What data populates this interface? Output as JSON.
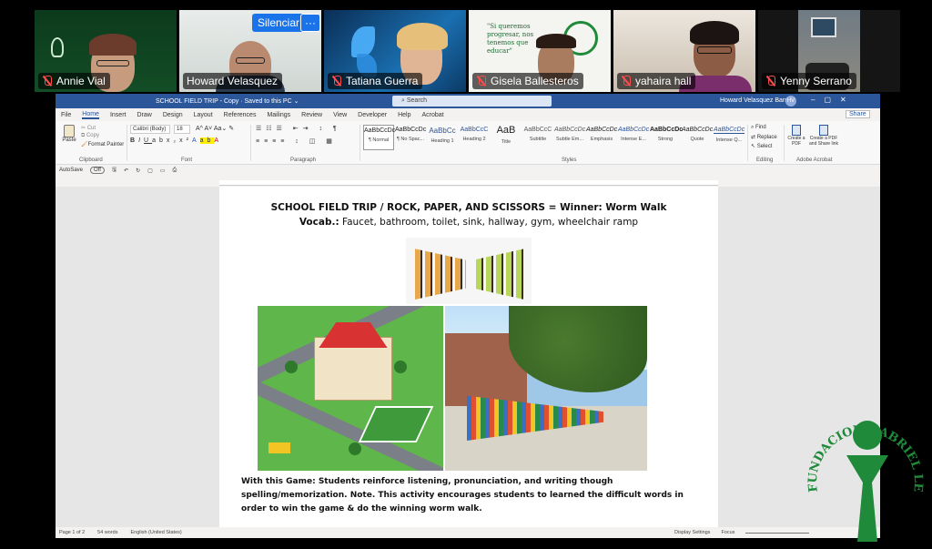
{
  "meeting": {
    "participants": [
      {
        "name": "Annie Vial",
        "muted": true
      },
      {
        "name": "Howard Velasquez",
        "muted": false,
        "speaking": true
      },
      {
        "name": "Tatiana Guerra",
        "muted": true
      },
      {
        "name": "Gisela Ballesteros",
        "muted": true
      },
      {
        "name": "yahaira hall",
        "muted": true
      },
      {
        "name": "Yenny Serrano",
        "muted": true
      }
    ],
    "mute_button": "Silenciar",
    "more_button": "···",
    "poster_text": "\"Si queremos progresar, nos tenemos que educar\""
  },
  "word": {
    "title_bar": {
      "document": "SCHOOL FIELD TRIP - Copy  ·  Saved to this PC ⌄",
      "search": "Search",
      "user": "Howard Velasquez Barrios",
      "avatar_initials": "HV"
    },
    "menu": [
      "File",
      "Home",
      "Insert",
      "Draw",
      "Design",
      "Layout",
      "References",
      "Mailings",
      "Review",
      "View",
      "Developer",
      "Help",
      "Acrobat"
    ],
    "active_menu": "Home",
    "share": "Share",
    "ribbon": {
      "clipboard": {
        "paste": "Paste",
        "cut": "Cut",
        "copy": "Copy",
        "format_painter": "Format Painter",
        "label": "Clipboard"
      },
      "font": {
        "family": "Calibri (Body)",
        "size": "18",
        "label": "Font"
      },
      "paragraph_label": "Paragraph",
      "styles": [
        {
          "preview": "AaBbCcDc",
          "name": "¶ Normal"
        },
        {
          "preview": "AaBbCcDc",
          "name": "¶ No Spac..."
        },
        {
          "preview": "AaBbCc",
          "name": "Heading 1"
        },
        {
          "preview": "AaBbCcC",
          "name": "Heading 2"
        },
        {
          "preview": "AaB",
          "name": "Title"
        },
        {
          "preview": "AaBbCcC",
          "name": "Subtitle"
        },
        {
          "preview": "AaBbCcDc",
          "name": "Subtle Em..."
        },
        {
          "preview": "AaBbCcDc",
          "name": "Emphasis"
        },
        {
          "preview": "AaBbCcDc",
          "name": "Intense E..."
        },
        {
          "preview": "AaBbCcDc",
          "name": "Strong"
        },
        {
          "preview": "AaBbCcDc",
          "name": "Quote"
        },
        {
          "preview": "AaBbCcDc",
          "name": "Intense Q..."
        }
      ],
      "styles_label": "Styles",
      "editing": {
        "find": "Find",
        "replace": "Replace",
        "select": "Select",
        "label": "Editing"
      },
      "acrobat": {
        "create_pdf": "Create a PDF",
        "create_share": "Create a PDF and Share link",
        "label": "Adobe Acrobat"
      }
    },
    "quick_access": {
      "autosave": "AutoSave",
      "autosave_state": "Off"
    },
    "document": {
      "title": "SCHOOL FIELD TRIP / ROCK, PAPER, AND SCISSORS = Winner: Worm Walk",
      "vocab_label": "Vocab.:",
      "vocab_text": " Faucet, bathroom, toilet, sink, hallway, gym, wheelchair ramp",
      "body": "With this Game: Students reinforce listening, pronunciation, and writing though spelling/memorization. Note. This activity encourages students to learned the difficult words in order to win the game & do the winning worm walk."
    },
    "status": {
      "page": "Page 1 of 2",
      "words": "54 words",
      "language": "English (United States)",
      "display_settings": "Display Settings",
      "focus": "Focus"
    }
  },
  "logo": {
    "text": "FUNDACION GABRIEL LEWIS GALINDO",
    "colors": {
      "green": "#1e8a3a",
      "dark_green": "#145c27"
    }
  }
}
